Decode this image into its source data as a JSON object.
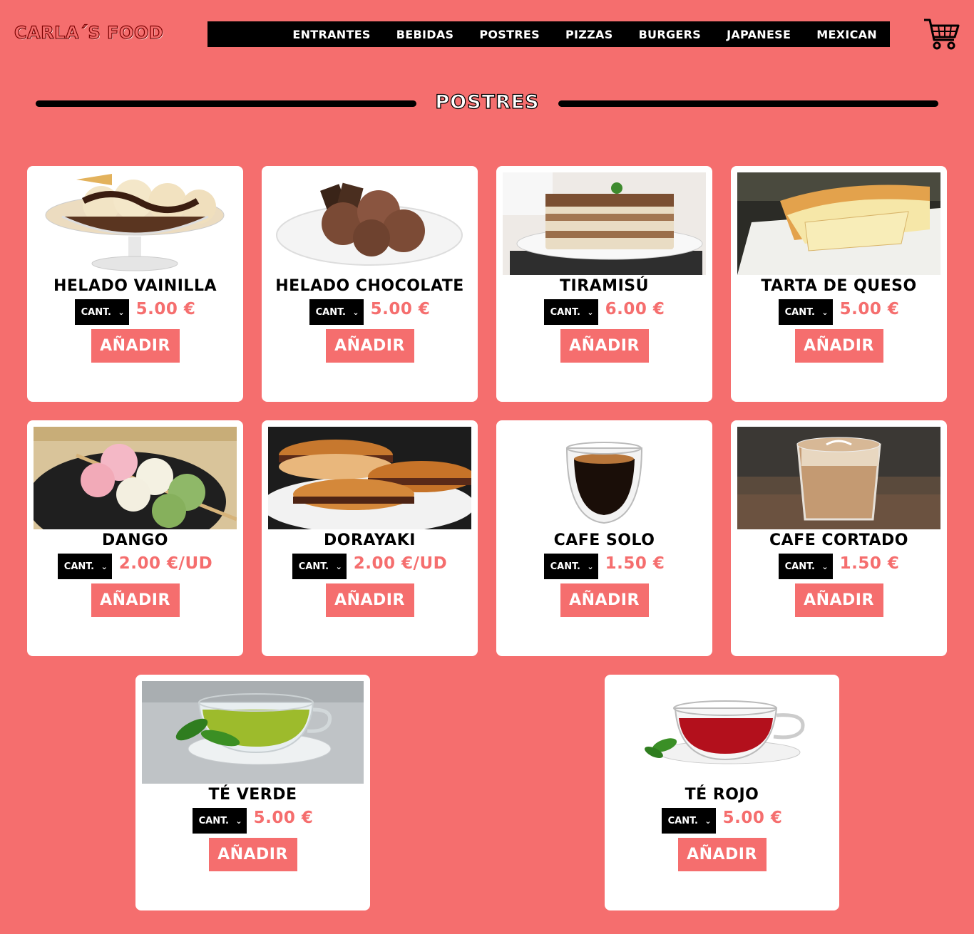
{
  "brand": {
    "logo_text": "CARLA´S FOOD"
  },
  "nav": {
    "items": [
      {
        "label": "ENTRANTES"
      },
      {
        "label": "BEBIDAS"
      },
      {
        "label": "POSTRES"
      },
      {
        "label": "PIZZAS"
      },
      {
        "label": "BURGERS"
      },
      {
        "label": "JAPANESE"
      },
      {
        "label": "MEXICAN"
      }
    ],
    "cart_icon": "shopping-cart-icon"
  },
  "section": {
    "title": "POSTRES"
  },
  "products": [
    {
      "name": "HELADO VAINILLA",
      "price": "5.00 €",
      "qty_placeholder": "CANT.",
      "add_label": "AÑADIR",
      "image": "vanilla-ice-cream-image"
    },
    {
      "name": "HELADO CHOCOLATE",
      "price": "5.00 €",
      "qty_placeholder": "CANT.",
      "add_label": "AÑADIR",
      "image": "chocolate-ice-cream-image"
    },
    {
      "name": "TIRAMISÚ",
      "price": "6.00 €",
      "qty_placeholder": "CANT.",
      "add_label": "AÑADIR",
      "image": "tiramisu-image"
    },
    {
      "name": "TARTA DE QUESO",
      "price": "5.00 €",
      "qty_placeholder": "CANT.",
      "add_label": "AÑADIR",
      "image": "cheesecake-image"
    },
    {
      "name": "DANGO",
      "price": "2.00 €/UD",
      "qty_placeholder": "CANT.",
      "add_label": "AÑADIR",
      "image": "dango-image"
    },
    {
      "name": "DORAYAKI",
      "price": "2.00 €/UD",
      "qty_placeholder": "CANT.",
      "add_label": "AÑADIR",
      "image": "dorayaki-image"
    },
    {
      "name": "CAFE SOLO",
      "price": "1.50 €",
      "qty_placeholder": "CANT.",
      "add_label": "AÑADIR",
      "image": "espresso-image"
    },
    {
      "name": "CAFE CORTADO",
      "price": "1.50 €",
      "qty_placeholder": "CANT.",
      "add_label": "AÑADIR",
      "image": "cortado-image"
    },
    {
      "name": "TÉ VERDE",
      "price": "5.00 €",
      "qty_placeholder": "CANT.",
      "add_label": "AÑADIR",
      "image": "green-tea-image"
    },
    {
      "name": "TÉ ROJO",
      "price": "5.00 €",
      "qty_placeholder": "CANT.",
      "add_label": "AÑADIR",
      "image": "red-tea-image"
    }
  ],
  "colors": {
    "background": "#f56e6e",
    "nav": "#000000",
    "card": "#ffffff",
    "accent": "#f56e6e"
  }
}
